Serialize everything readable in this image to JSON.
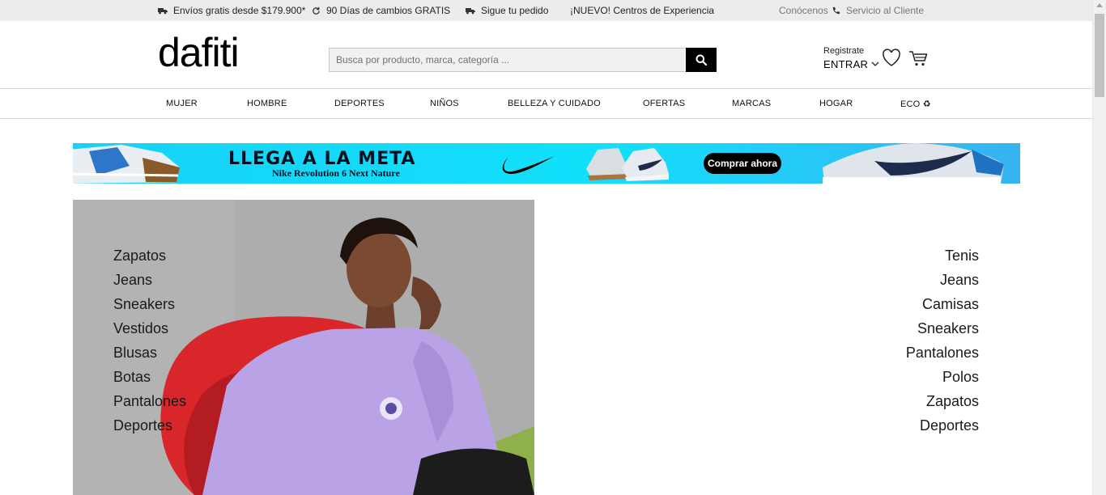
{
  "topbar": {
    "shipping": "Envíos gratis desde $179.900*",
    "returns": "90 Días de cambios GRATIS",
    "tracking": "Sigue tu pedido",
    "experience": "¡NUEVO! Centros de Experiencia",
    "about": "Conócenos",
    "support": "Servicio al Cliente"
  },
  "header": {
    "logo": "dafiti",
    "search_placeholder": "Busca por producto, marca, categoría ...",
    "register": "Registrate",
    "login": "ENTRAR"
  },
  "nav": [
    "MUJER",
    "HOMBRE",
    "DEPORTES",
    "NIÑOS",
    "BELLEZA Y CUIDADO",
    "OFERTAS",
    "MARCAS",
    "HOGAR",
    "ECO ♻"
  ],
  "banner": {
    "headline": "LLEGA A LA META",
    "subline": "Nike Revolution 6 Next Nature",
    "cta": "Comprar ahora"
  },
  "women_links": [
    "Zapatos",
    "Jeans",
    "Sneakers",
    "Vestidos",
    "Blusas",
    "Botas",
    "Pantalones",
    "Deportes"
  ],
  "men_links": [
    "Tenis",
    "Jeans",
    "Camisas",
    "Sneakers",
    "Pantalones",
    "Polos",
    "Zapatos",
    "Deportes"
  ],
  "colors": {
    "topbar_bg": "#ececec",
    "banner_bg": "#17d2f6",
    "sweater": "#b9a3e6",
    "chair": "#d8262a"
  },
  "icons": [
    "truck-icon",
    "refresh-icon",
    "truck-icon",
    "phone-icon",
    "search-icon",
    "chevron-down-icon",
    "heart-icon",
    "cart-icon",
    "nike-swoosh-icon"
  ]
}
